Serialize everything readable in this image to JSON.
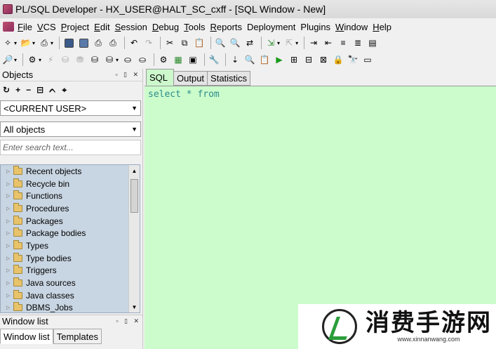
{
  "window": {
    "title": "PL/SQL Developer - HX_USER@HALT_SC_cxff - [SQL Window - New]"
  },
  "menu": [
    {
      "label": "File",
      "underline": "F",
      "rest": "ile"
    },
    {
      "label": "VCS",
      "underline": "V",
      "rest": "CS"
    },
    {
      "label": "Project",
      "underline": "P",
      "rest": "roject"
    },
    {
      "label": "Edit",
      "underline": "E",
      "rest": "dit"
    },
    {
      "label": "Session",
      "underline": "S",
      "rest": "ession"
    },
    {
      "label": "Debug",
      "underline": "D",
      "rest": "ebug"
    },
    {
      "label": "Tools",
      "underline": "T",
      "rest": "ools"
    },
    {
      "label": "Reports",
      "underline": "R",
      "rest": "eports"
    },
    {
      "label": "Deployment",
      "underline": "",
      "rest": "Deployment"
    },
    {
      "label": "Plugins",
      "underline": "",
      "rest": "Plugins"
    },
    {
      "label": "Window",
      "underline": "W",
      "rest": "indow"
    },
    {
      "label": "Help",
      "underline": "H",
      "rest": "elp"
    }
  ],
  "objects_panel": {
    "title": "Objects",
    "controls": "▫ ▯ ✕",
    "user_combo": "<CURRENT USER>",
    "filter_combo": "All objects",
    "search_placeholder": "Enter search text...",
    "tree": [
      "Recent objects",
      "Recycle bin",
      "Functions",
      "Procedures",
      "Packages",
      "Package bodies",
      "Types",
      "Type bodies",
      "Triggers",
      "Java sources",
      "Java classes",
      "DBMS_Jobs"
    ]
  },
  "window_list": {
    "title": "Window list",
    "controls": "▫ ▯ ✕",
    "tabs": [
      "Window list",
      "Templates"
    ]
  },
  "editor": {
    "tabs": [
      "SQL",
      "Output",
      "Statistics"
    ],
    "text": "select * from"
  },
  "watermark": {
    "name": "消费手游网",
    "url": "www.xinnanwang.com"
  },
  "colors": {
    "editor_bg": "#ccfccc",
    "keyword": "#2e8b8b",
    "tree_bg": "#c8d5e2"
  }
}
